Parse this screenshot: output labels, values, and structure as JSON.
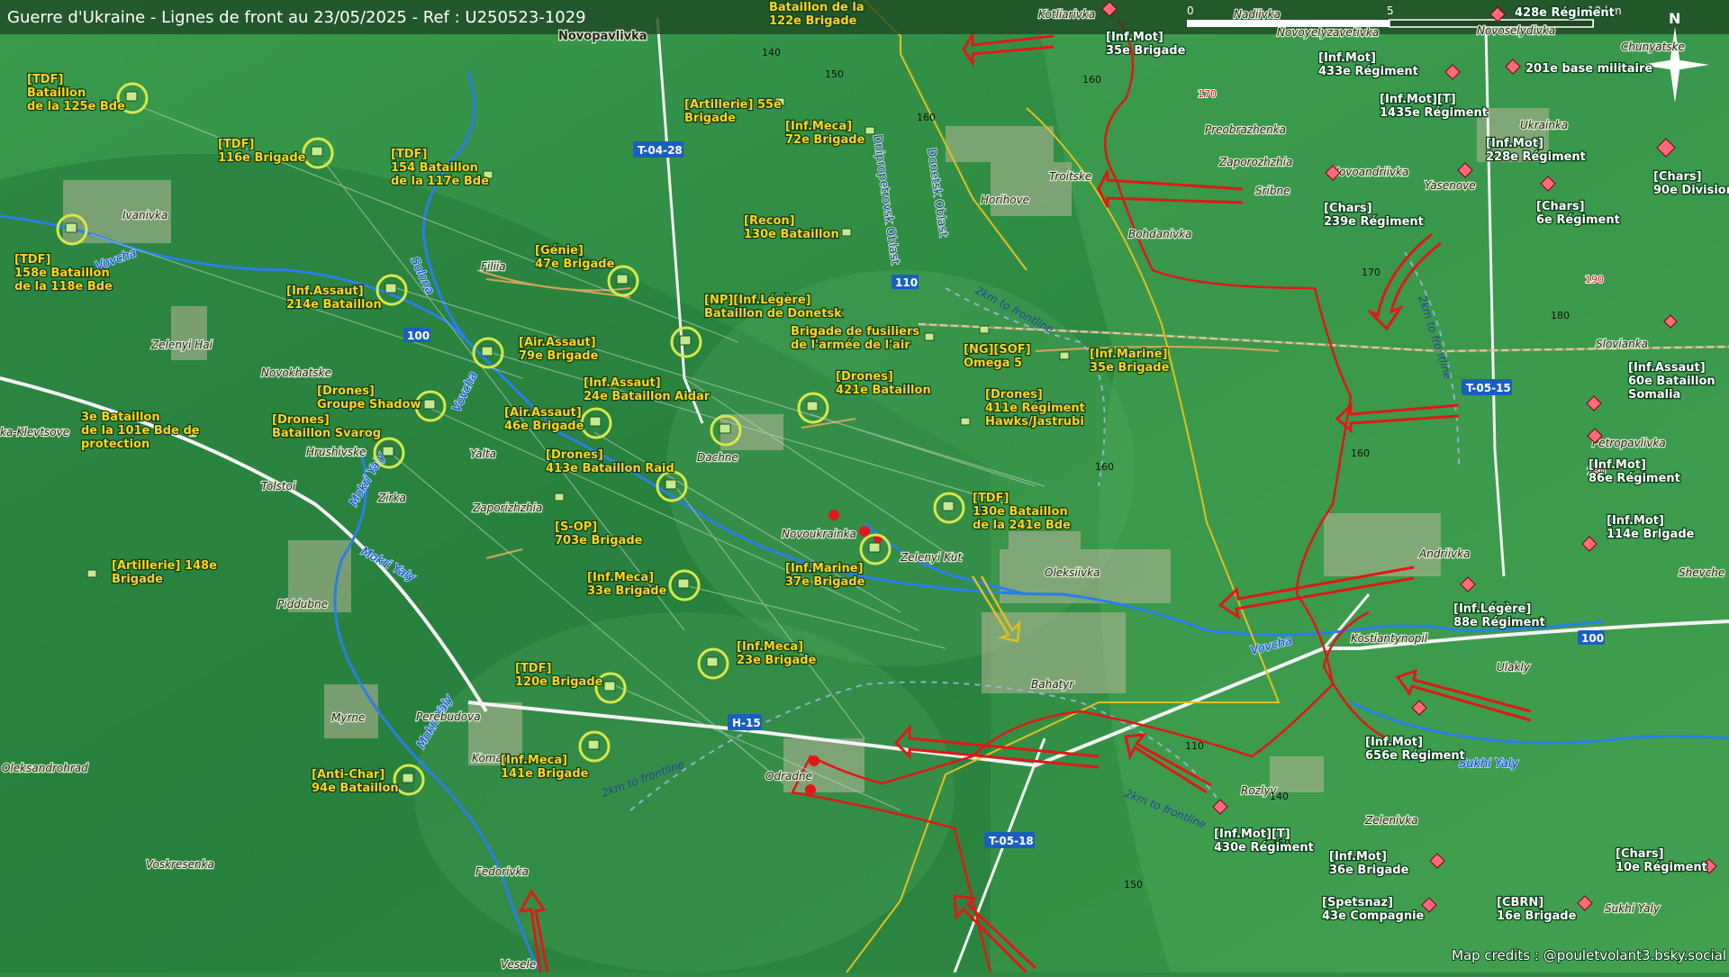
{
  "title": "Guerre d'Ukraine - Lignes de front au 23/05/2025 - Ref : U250523-1029",
  "credits": "Map credits : @pouletvolant3.bsky.social",
  "scale": {
    "labels": [
      "0",
      "5",
      "10 km"
    ]
  },
  "north": "N",
  "roads": [
    "T-04-28",
    "H-15",
    "T-05-15",
    "T-05-18",
    "100",
    "110"
  ],
  "oblasts": [
    "Dnipropetrovsk Oblast",
    "Donetsk Oblast"
  ],
  "frontline_note": "2km to frontline",
  "rivers": [
    "Vovcha",
    "Solona",
    "Mokri Yaly",
    "Sukhi Yaly"
  ],
  "towns": [
    "Novopavlivka",
    "Ivanivka",
    "Zelenyi Hai",
    "Novokhatske",
    "Hrushivske",
    "Tolstoi",
    "Zirka",
    "Yalta",
    "Zaporizhzhia",
    "Dachne",
    "Filiia",
    "Novoukrainka",
    "Zelenyi Kut",
    "Oleksiivka",
    "Piddubne",
    "Myrne",
    "Perebudova",
    "Komar",
    "Oleksandrohrad",
    "Voskresenka",
    "Fedorivka",
    "Vesele",
    "Odradne",
    "Bahatyr",
    "Andriivka",
    "Kostiantynopil",
    "Ulakly",
    "Rozlyv",
    "Zelenivka",
    "Sukhi Yaly",
    "Shevche",
    "Petropavlivka",
    "Slovianka",
    "Ukrainka",
    "Yasenove",
    "Novoandriivka",
    "Zaporozhzhia",
    "Sribne",
    "Troitske",
    "Horihove",
    "Bohdanivka",
    "Preobrazhenka",
    "Kotliarivka",
    "Nadiivka",
    "Novoyelyzavetivka",
    "Novoselydivka",
    "Chunyatske",
    "ka-Klevtsove"
  ],
  "elevations": [
    "140",
    "150",
    "160",
    "170",
    "180",
    "190",
    "110",
    "150",
    "160",
    "170",
    "160",
    "180",
    "140",
    "150",
    "160"
  ],
  "ukraine_units": [
    "[TDF]|Bataillon|de la 125e Bde",
    "[TDF]|116e Brigade",
    "[TDF]|154 Bataillon|de la 117e Bde",
    "[TDF]|158e Bataillon|de la 118e Bde",
    "[Inf.Assaut]|214e Bataillon",
    "[Génie]|47e Brigade",
    "[Recon]|130e Bataillon",
    "[Artillerie] 55e|Brigade",
    "[Inf.Meca]|72e Brigade",
    "Bataillon de la|122e Brigade",
    "[NP][Inf.Légère]|Bataillon de Donetsk",
    "Brigade de fusiliers|de l'armée de l'air",
    "[NG][SOF]|Omega 5",
    "[Inf.Marine]|35e Brigade",
    "[Air.Assaut]|79e Brigade",
    "[Drones]|Groupe Shadow",
    "[Drones]|Bataillon Svarog",
    "3e Bataillon|de la 101e Bde de|protection",
    "[Air.Assaut]|46e Brigade",
    "[Inf.Assaut]|24e Bataillon Aidar",
    "[Drones]|421e Bataillon",
    "[Drones]|411e Régiment|Hawks/Jastrubi",
    "[Drones]|413e Bataillon Raid",
    "[S-OP]|703e Brigade",
    "[TDF]|130e Bataillon|de la 241e Bde",
    "[Inf.Marine]|37e Brigade",
    "[Inf.Meca]|33e Brigade",
    "[Artillerie] 148e|Brigade",
    "[Inf.Meca]|23e Brigade",
    "[TDF]|120e Brigade",
    "[Inf.Meca]|141e Brigade",
    "[Anti-Char]|94e Bataillon"
  ],
  "russia_units": [
    "[Inf.Mot]|35e Brigade",
    "[Inf.Mot]|433e Régiment",
    "[Inf.Mot][T]|1435e Régiment",
    "201e base militaire",
    "[Inf.Mot]|228e Régiment",
    "[Chars]|90e Division",
    "[Chars]|239e Régiment",
    "[Chars]|6e Régiment",
    "[Inf.Assaut]|60e Bataillon|Somalia",
    "[Inf.Mot]|86e Régiment",
    "[Inf.Mot]|114e Brigade",
    "[Inf.Légère]|88e Régiment",
    "[Inf.Mot]|656e Régiment",
    "[Inf.Mot][T]|430e Régiment",
    "[Inf.Mot]|36e Brigade",
    "[Spetsnaz]|43e Compagnie",
    "[CBRN]|16e Brigade",
    "[Chars]|10e Régiment",
    "428e Régiment"
  ],
  "colors": {
    "frontline": "#e01818",
    "ua_unit": "#ffd21f",
    "ru_unit": "#ff6b7a",
    "water": "#2a7fe8",
    "road": "#f2f2f2",
    "oblast_border": "#e0c020"
  }
}
